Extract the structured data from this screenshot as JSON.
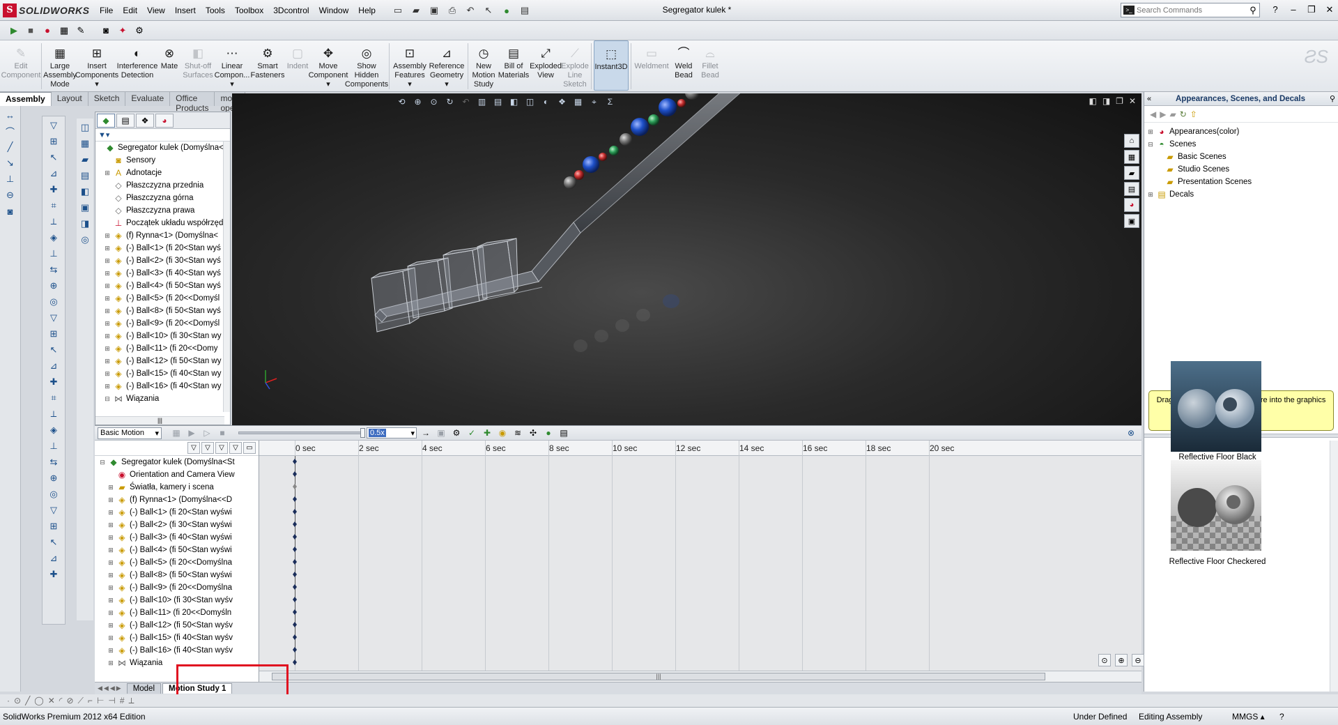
{
  "app": {
    "logo_text": "SOLIDWORKS",
    "doc_title": "Segregator kulek *",
    "search_placeholder": "Search Commands"
  },
  "menu": [
    "File",
    "Edit",
    "View",
    "Insert",
    "Tools",
    "Toolbox",
    "3Dcontrol",
    "Window",
    "Help"
  ],
  "ribbon": [
    {
      "label": "Edit\nComponent",
      "icon": "edit-component-icon",
      "state": "disabled"
    },
    {
      "label": "Large\nAssembly\nMode",
      "icon": "large-assembly-icon",
      "state": "normal"
    },
    {
      "label": "Insert\nComponents\n▾",
      "icon": "insert-components-icon",
      "state": "normal"
    },
    {
      "label": "Interference\nDetection",
      "icon": "interference-icon",
      "state": "normal"
    },
    {
      "label": "Mate",
      "icon": "mate-icon",
      "state": "normal"
    },
    {
      "label": "Shut-off\nSurfaces",
      "icon": "shutoff-icon",
      "state": "disabled"
    },
    {
      "label": "Linear\nCompon...\n▾",
      "icon": "linear-pattern-icon",
      "state": "normal"
    },
    {
      "label": "Smart\nFasteners",
      "icon": "fastener-icon",
      "state": "normal"
    },
    {
      "label": "Indent",
      "icon": "indent-icon",
      "state": "disabled"
    },
    {
      "label": "Move\nComponent\n▾",
      "icon": "move-icon",
      "state": "normal"
    },
    {
      "label": "Show\nHidden\nComponents",
      "icon": "show-hidden-icon",
      "state": "normal"
    },
    {
      "label": "Assembly\nFeatures\n▾",
      "icon": "assembly-features-icon",
      "state": "normal"
    },
    {
      "label": "Reference\nGeometry\n▾",
      "icon": "ref-geometry-icon",
      "state": "normal"
    },
    {
      "label": "New\nMotion\nStudy",
      "icon": "motion-study-icon",
      "state": "normal"
    },
    {
      "label": "Bill of\nMaterials",
      "icon": "bom-icon",
      "state": "normal"
    },
    {
      "label": "Exploded\nView",
      "icon": "exploded-icon",
      "state": "normal"
    },
    {
      "label": "Explode\nLine\nSketch",
      "icon": "explode-line-icon",
      "state": "disabled"
    },
    {
      "label": "Instant3D",
      "icon": "instant3d-icon",
      "state": "active"
    },
    {
      "label": "Weldment",
      "icon": "weldment-icon",
      "state": "disabled"
    },
    {
      "label": "Weld\nBead",
      "icon": "weld-bead-icon",
      "state": "normal"
    },
    {
      "label": "Fillet\nBead",
      "icon": "fillet-bead-icon",
      "state": "disabled"
    }
  ],
  "cm_tabs": [
    "Assembly",
    "Layout",
    "Sketch",
    "Evaluate",
    "Office Products",
    "moje oper"
  ],
  "feature_tree": [
    {
      "label": "Segregator kulek  (Domyślna<",
      "icon": "assembly-icon",
      "color": "grn",
      "level": 0
    },
    {
      "label": "Sensory",
      "icon": "sensor-icon",
      "color": "yel",
      "level": 1
    },
    {
      "label": "Adnotacje",
      "icon": "annotation-icon",
      "color": "yel",
      "level": 1,
      "exp": "+"
    },
    {
      "label": "Płaszczyzna przednia",
      "icon": "plane-icon",
      "color": "gry",
      "level": 1
    },
    {
      "label": "Płaszczyzna górna",
      "icon": "plane-icon",
      "color": "gry",
      "level": 1
    },
    {
      "label": "Płaszczyzna prawa",
      "icon": "plane-icon",
      "color": "gry",
      "level": 1
    },
    {
      "label": "Początek układu współrzęd",
      "icon": "origin-icon",
      "color": "red",
      "level": 1
    },
    {
      "label": "(f) Rynna<1> (Domyślna<",
      "icon": "part-icon",
      "color": "yel",
      "level": 1,
      "exp": "+"
    },
    {
      "label": "(-) Ball<1> (fi 20<Stan wyś",
      "icon": "part-icon",
      "color": "yel",
      "level": 1,
      "exp": "+"
    },
    {
      "label": "(-) Ball<2> (fi 30<Stan wyś",
      "icon": "part-icon",
      "color": "yel",
      "level": 1,
      "exp": "+"
    },
    {
      "label": "(-) Ball<3> (fi 40<Stan wyś",
      "icon": "part-icon",
      "color": "yel",
      "level": 1,
      "exp": "+"
    },
    {
      "label": "(-) Ball<4> (fi 50<Stan wyś",
      "icon": "part-icon",
      "color": "yel",
      "level": 1,
      "exp": "+"
    },
    {
      "label": "(-) Ball<5> (fi 20<<Domyśl",
      "icon": "part-icon",
      "color": "yel",
      "level": 1,
      "exp": "+"
    },
    {
      "label": "(-) Ball<8> (fi 50<Stan wyś",
      "icon": "part-icon",
      "color": "yel",
      "level": 1,
      "exp": "+"
    },
    {
      "label": "(-) Ball<9> (fi 20<<Domyśl",
      "icon": "part-icon",
      "color": "yel",
      "level": 1,
      "exp": "+"
    },
    {
      "label": "(-) Ball<10> (fi 30<Stan wy",
      "icon": "part-icon",
      "color": "yel",
      "level": 1,
      "exp": "+"
    },
    {
      "label": "(-) Ball<11> (fi 20<<Domy",
      "icon": "part-icon",
      "color": "yel",
      "level": 1,
      "exp": "+"
    },
    {
      "label": "(-) Ball<12> (fi 50<Stan wy",
      "icon": "part-icon",
      "color": "yel",
      "level": 1,
      "exp": "+"
    },
    {
      "label": "(-) Ball<15> (fi 40<Stan wy",
      "icon": "part-icon",
      "color": "yel",
      "level": 1,
      "exp": "+"
    },
    {
      "label": "(-) Ball<16> (fi 40<Stan wy",
      "icon": "part-icon",
      "color": "yel",
      "level": 1,
      "exp": "+"
    },
    {
      "label": "Wiązania",
      "icon": "mates-icon",
      "color": "gry",
      "level": 1,
      "exp": "−"
    }
  ],
  "taskpane": {
    "title": "Appearances, Scenes, and Decals",
    "tree": [
      {
        "label": "Appearances(color)",
        "icon": "appearance-icon",
        "level": 0,
        "exp": "+"
      },
      {
        "label": "Scenes",
        "icon": "scenes-icon",
        "level": 0,
        "exp": "−"
      },
      {
        "label": "Basic Scenes",
        "icon": "folder-icon",
        "level": 1
      },
      {
        "label": "Studio Scenes",
        "icon": "folder-icon",
        "level": 1
      },
      {
        "label": "Presentation Scenes",
        "icon": "folder-icon",
        "level": 1
      },
      {
        "label": "Decals",
        "icon": "decals-icon",
        "level": 0,
        "exp": "+"
      }
    ],
    "hint": "Drag and drop scenes anywhere into the graphics view.",
    "thumbs": [
      "Reflective Floor Black",
      "Reflective Floor Checkered"
    ]
  },
  "motion": {
    "study_type": "Basic Motion",
    "playback_speed": "0.5x",
    "time_labels": [
      "0 sec",
      "2 sec",
      "4 sec",
      "6 sec",
      "8 sec",
      "10 sec",
      "12 sec",
      "14 sec",
      "16 sec",
      "18 sec",
      "20 sec"
    ],
    "tree": [
      {
        "label": "Segregator kulek  (Domyślna<St",
        "icon": "assembly-icon",
        "color": "grn",
        "exp": "−",
        "level": 0
      },
      {
        "label": "Orientation and Camera View",
        "icon": "camera-icon",
        "color": "red",
        "level": 1
      },
      {
        "label": "Światła, kamery i scena",
        "icon": "lights-icon",
        "color": "yel",
        "exp": "+",
        "level": 1
      },
      {
        "label": "(f) Rynna<1> (Domyślna<<D",
        "icon": "part-icon",
        "color": "yel",
        "exp": "+",
        "level": 1
      },
      {
        "label": "(-) Ball<1> (fi 20<Stan wyświ",
        "icon": "part-icon",
        "color": "yel",
        "exp": "+",
        "level": 1
      },
      {
        "label": "(-) Ball<2> (fi 30<Stan wyświ",
        "icon": "part-icon",
        "color": "yel",
        "exp": "+",
        "level": 1
      },
      {
        "label": "(-) Ball<3> (fi 40<Stan wyświ",
        "icon": "part-icon",
        "color": "yel",
        "exp": "+",
        "level": 1
      },
      {
        "label": "(-) Ball<4> (fi 50<Stan wyświ",
        "icon": "part-icon",
        "color": "yel",
        "exp": "+",
        "level": 1
      },
      {
        "label": "(-) Ball<5> (fi 20<<Domyślna",
        "icon": "part-icon",
        "color": "yel",
        "exp": "+",
        "level": 1
      },
      {
        "label": "(-) Ball<8> (fi 50<Stan wyświ",
        "icon": "part-icon",
        "color": "yel",
        "exp": "+",
        "level": 1
      },
      {
        "label": "(-) Ball<9> (fi 20<<Domyślna",
        "icon": "part-icon",
        "color": "yel",
        "exp": "+",
        "level": 1
      },
      {
        "label": "(-) Ball<10> (fi 30<Stan wyśv",
        "icon": "part-icon",
        "color": "yel",
        "exp": "+",
        "level": 1
      },
      {
        "label": "(-) Ball<11> (fi 20<<Domyśln",
        "icon": "part-icon",
        "color": "yel",
        "exp": "+",
        "level": 1
      },
      {
        "label": "(-) Ball<12> (fi 50<Stan wyśv",
        "icon": "part-icon",
        "color": "yel",
        "exp": "+",
        "level": 1
      },
      {
        "label": "(-) Ball<15> (fi 40<Stan wyśv",
        "icon": "part-icon",
        "color": "yel",
        "exp": "+",
        "level": 1
      },
      {
        "label": "(-) Ball<16> (fi 40<Stan wyśv",
        "icon": "part-icon",
        "color": "yel",
        "exp": "+",
        "level": 1
      },
      {
        "label": "Wiązania",
        "icon": "mates-icon",
        "color": "gry",
        "exp": "+",
        "level": 1
      }
    ],
    "tabs": [
      "Model",
      "Motion Study 1"
    ],
    "active_tab": "Motion Study 1"
  },
  "status": {
    "edition": "SolidWorks Premium 2012 x64 Edition",
    "state": "Under Defined",
    "mode": "Editing Assembly",
    "units": "MMGS"
  },
  "colors": {
    "highlight": "#e01020",
    "ball_blue": "#1e50c8",
    "ball_green": "#2ea05a",
    "ball_red": "#c83030",
    "ball_gray": "#8a8a8a"
  }
}
